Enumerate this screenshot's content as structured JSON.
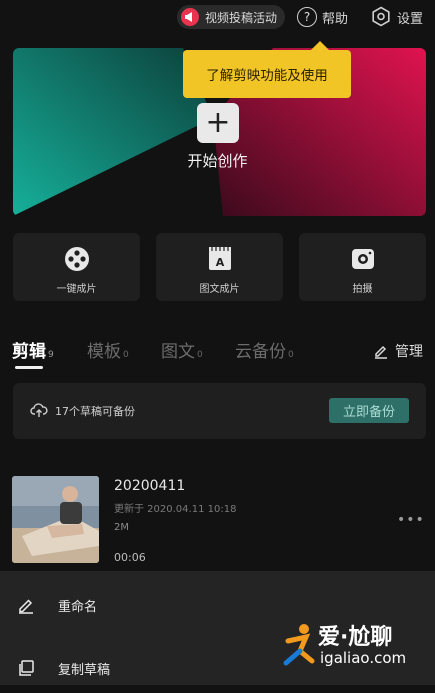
{
  "topbar": {
    "activity_label": "视频投稿活动",
    "help_label": "帮助",
    "settings_label": "设置"
  },
  "tooltip": {
    "text": "了解剪映功能及使用"
  },
  "hero": {
    "label": "开始创作"
  },
  "actions": [
    {
      "label": "一键成片",
      "icon": "film-reel-icon"
    },
    {
      "label": "图文成片",
      "icon": "text-to-video-icon"
    },
    {
      "label": "拍摄",
      "icon": "camera-icon"
    }
  ],
  "tabs": [
    {
      "label": "剪辑",
      "count": "9",
      "active": true
    },
    {
      "label": "模板",
      "count": "0",
      "active": false
    },
    {
      "label": "图文",
      "count": "0",
      "active": false
    },
    {
      "label": "云备份",
      "count": "0",
      "active": false
    }
  ],
  "manage_label": "管理",
  "backup": {
    "text": "17个草稿可备份",
    "button_label": "立即备份"
  },
  "draft": {
    "name": "20200411",
    "updated": "更新于 2020.04.11 10:18",
    "size": "2M",
    "duration": "00:06",
    "more": "•••"
  },
  "sheet": {
    "rename_label": "重命名",
    "copy_label": "复制草稿"
  },
  "watermark": {
    "line1": "爱·尬聊",
    "line2": "igaliao.com"
  },
  "colors": {
    "accent_teal": "#1a9e8c",
    "accent_pink": "#c8144a",
    "tooltip_yellow": "#f1c526",
    "backup_button": "#2e6f68"
  }
}
